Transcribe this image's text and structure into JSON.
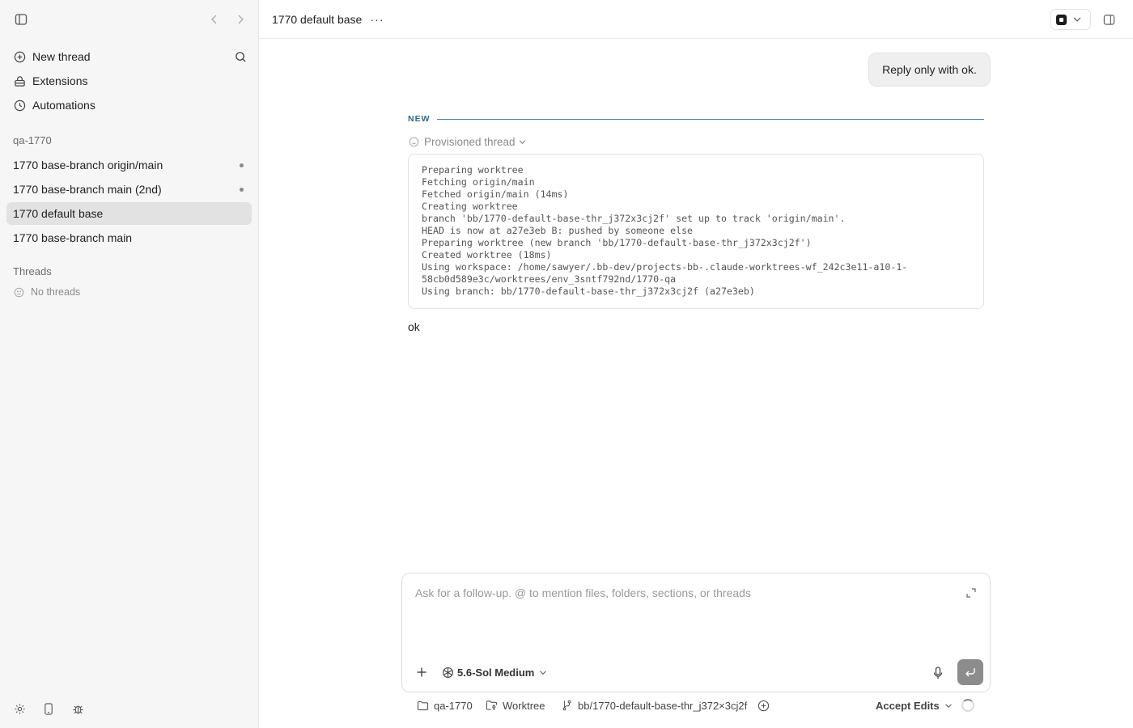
{
  "sidebar": {
    "nav": [
      {
        "label": "New thread",
        "icon": "plus-circle-icon"
      },
      {
        "label": "Extensions",
        "icon": "extensions-icon"
      },
      {
        "label": "Automations",
        "icon": "clock-icon"
      }
    ],
    "project": {
      "name": "qa-1770",
      "threads": [
        {
          "label": "1770 base-branch origin/main",
          "unread": true
        },
        {
          "label": "1770 base-branch main (2nd)",
          "unread": true
        },
        {
          "label": "1770 default base",
          "active": true
        },
        {
          "label": "1770 base-branch main"
        }
      ]
    },
    "threads_section": {
      "title": "Threads",
      "empty_label": "No threads"
    }
  },
  "header": {
    "title": "1770 default base",
    "more_label": "···"
  },
  "conversation": {
    "user_message": "Reply only with ok.",
    "divider_label": "NEW",
    "provisioned_label": "Provisioned thread",
    "log_lines": [
      "Preparing worktree",
      "Fetching origin/main",
      "Fetched origin/main (14ms)",
      "Creating worktree",
      "branch 'bb/1770-default-base-thr_j372x3cj2f' set up to track 'origin/main'.",
      "HEAD is now at a27e3eb B: pushed by someone else",
      "Preparing worktree (new branch 'bb/1770-default-base-thr_j372x3cj2f')",
      "Created worktree (18ms)",
      "Using workspace: /home/sawyer/.bb-dev/projects-bb-.claude-worktrees-wf_242c3e11-a10-1-",
      "58cb0d589e3c/worktrees/env_3sntf792nd/1770-qa",
      "Using branch: bb/1770-default-base-thr_j372x3cj2f (a27e3eb)"
    ],
    "assistant_reply": "ok"
  },
  "composer": {
    "placeholder": "Ask for a follow-up. @ to mention files, folders, sections, or threads",
    "model_label": "5.6-Sol Medium"
  },
  "status_bar": {
    "project": "qa-1770",
    "mode": "Worktree",
    "branch": "bb/1770-default-base-thr_j372×3cj2f",
    "accept_label": "Accept Edits"
  },
  "colors": {
    "sidebar_bg": "#f6f6f6",
    "active_item_bg": "#e2e2e2",
    "divider_accent": "#2f6a8c",
    "send_button": "#8c8c8c"
  }
}
